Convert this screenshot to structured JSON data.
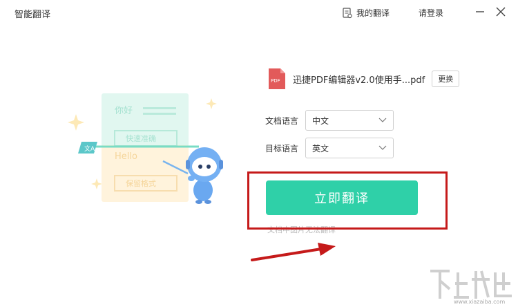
{
  "titlebar": {
    "app_title": "智能翻译",
    "my_translations": "我的翻译",
    "login": "请登录",
    "minimize_icon": "minimize-icon",
    "close_icon": "close-icon"
  },
  "illustration": {
    "card_top_text": "你好",
    "card_top_button": "快速准确",
    "card_bottom_text": "Hello",
    "card_bottom_button": "保留格式",
    "translate_badge": "文A"
  },
  "file": {
    "icon_text": "PDF",
    "name": "迅捷PDF编辑器v2.0使用手...pdf",
    "change_label": "更换"
  },
  "source_language": {
    "label": "文档语言",
    "value": "中文"
  },
  "target_language": {
    "label": "目标语言",
    "value": "英文"
  },
  "translate_button": "立即翻译",
  "note": "文档中图片无法翻译",
  "watermark": {
    "text": "www.xiazaiba.com"
  },
  "colors": {
    "accent": "#2fd0a8",
    "highlight_red": "#c51a1a",
    "pdf_red": "#e25a5a"
  }
}
